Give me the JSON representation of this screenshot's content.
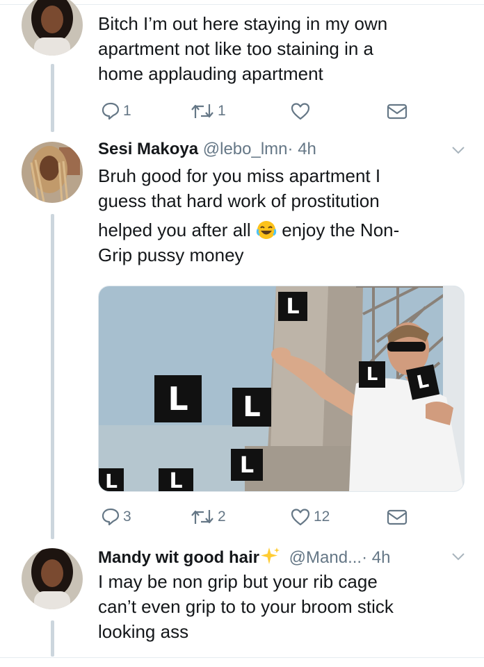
{
  "tweets": [
    {
      "text_lines": [
        "Bitch I’m out here staying in my own",
        "apartment not like too staining in a",
        "home applauding apartment"
      ],
      "replies": "1",
      "retweets": "1",
      "likes": ""
    },
    {
      "name": "Sesi Makoya",
      "handle": "@lebo_lmn",
      "time": "· 4h",
      "text_lines": [
        "Bruh good for you miss apartment I",
        "guess that hard work of prostitution",
        "helped you after all",
        "enjoy the Non-",
        "Grip pussy money"
      ],
      "image_letter": "L",
      "replies": "3",
      "retweets": "2",
      "likes": "12"
    },
    {
      "name": "Mandy wit good hair",
      "handle": "@Mand...",
      "time": "· 4h",
      "text_lines": [
        "I may be non grip but your rib cage",
        "can’t even grip to to your broom stick",
        "looking ass"
      ]
    }
  ],
  "icons": [
    "reply-icon",
    "retweet-icon",
    "like-icon",
    "dm-icon",
    "chevron-down-icon",
    "sparkles-emoji",
    "laughing-emoji"
  ],
  "colors": {
    "icon_gray": "#657786",
    "thread_line": "#ccd6dd",
    "sparkle": "#ffcc33"
  }
}
